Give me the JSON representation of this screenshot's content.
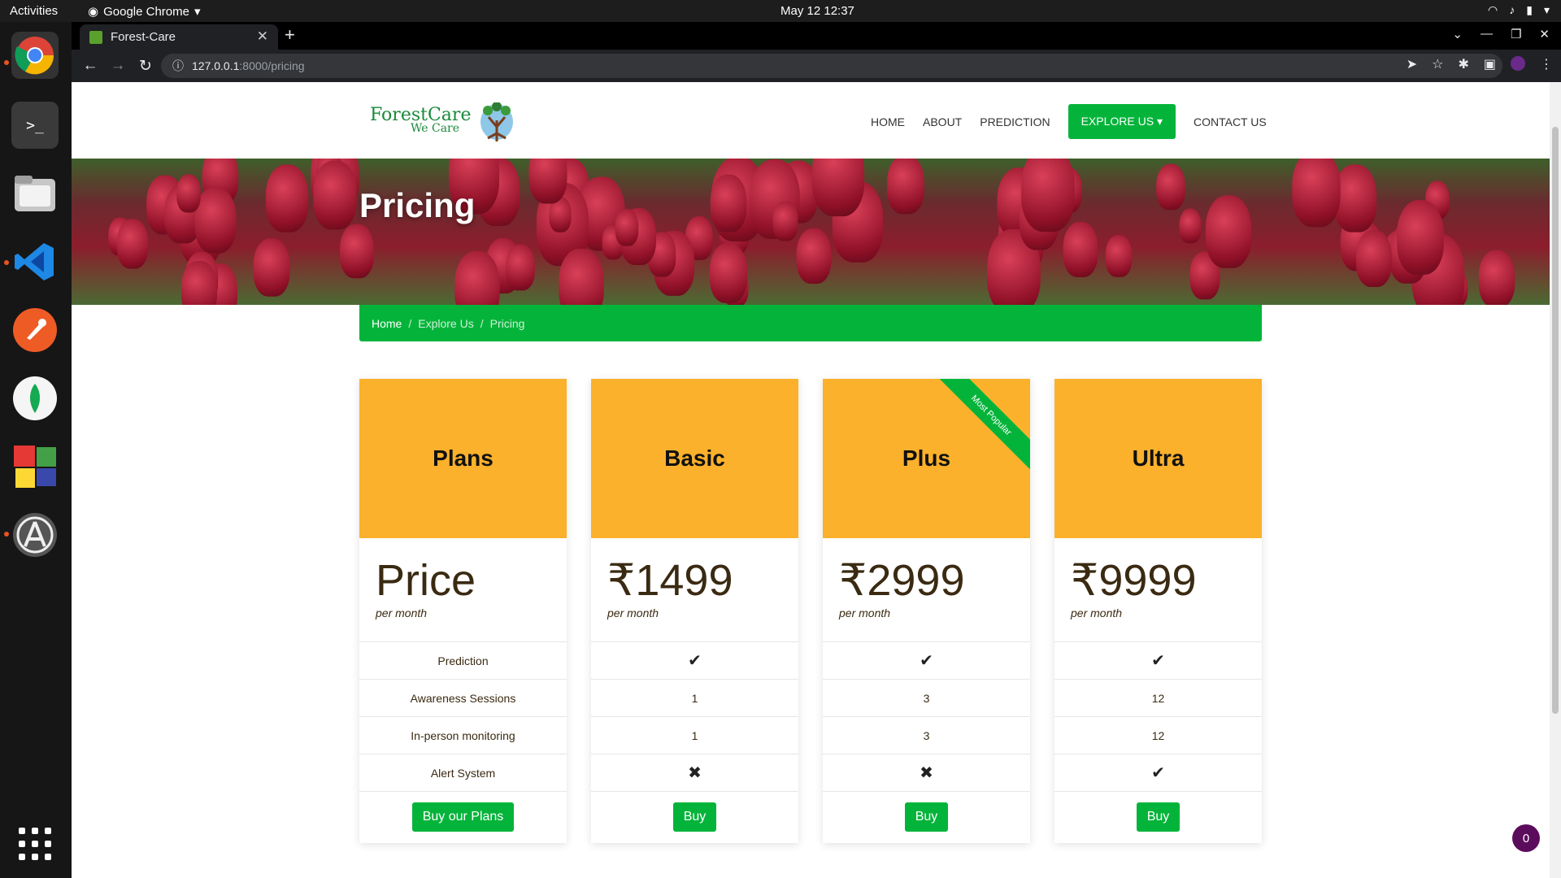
{
  "os": {
    "activities": "Activities",
    "app_name": "Google Chrome",
    "clock": "May 12  12:37"
  },
  "browser": {
    "tab_title": "Forest-Care",
    "url_host": "127.0.0.1",
    "url_path": ":8000/pricing"
  },
  "site": {
    "logo_line1": "ForestCare",
    "logo_line2": "We Care",
    "nav": {
      "home": "HOME",
      "about": "ABOUT",
      "prediction": "PREDICTION",
      "explore": "EXPLORE US",
      "contact": "CONTACT US"
    },
    "hero_title": "Pricing",
    "breadcrumb": {
      "home": "Home",
      "explore": "Explore Us",
      "current": "Pricing",
      "separator": "/"
    }
  },
  "pricing": {
    "ribbon": "Most Popular",
    "plans": {
      "title": "Plans",
      "price": "Price",
      "per": "per month",
      "features": [
        "Prediction",
        "Awareness Sessions",
        "In-person monitoring",
        "Alert System"
      ],
      "button": "Buy our Plans"
    },
    "basic": {
      "title": "Basic",
      "price": "₹1499",
      "per": "per month",
      "features": [
        "✔",
        "1",
        "1",
        "✖"
      ],
      "button": "Buy"
    },
    "plus": {
      "title": "Plus",
      "price": "₹2999",
      "per": "per month",
      "features": [
        "✔",
        "3",
        "3",
        "✖"
      ],
      "button": "Buy"
    },
    "ultra": {
      "title": "Ultra",
      "price": "₹9999",
      "per": "per month",
      "features": [
        "✔",
        "12",
        "12",
        "✔"
      ],
      "button": "Buy"
    }
  },
  "chat_badge": "0"
}
